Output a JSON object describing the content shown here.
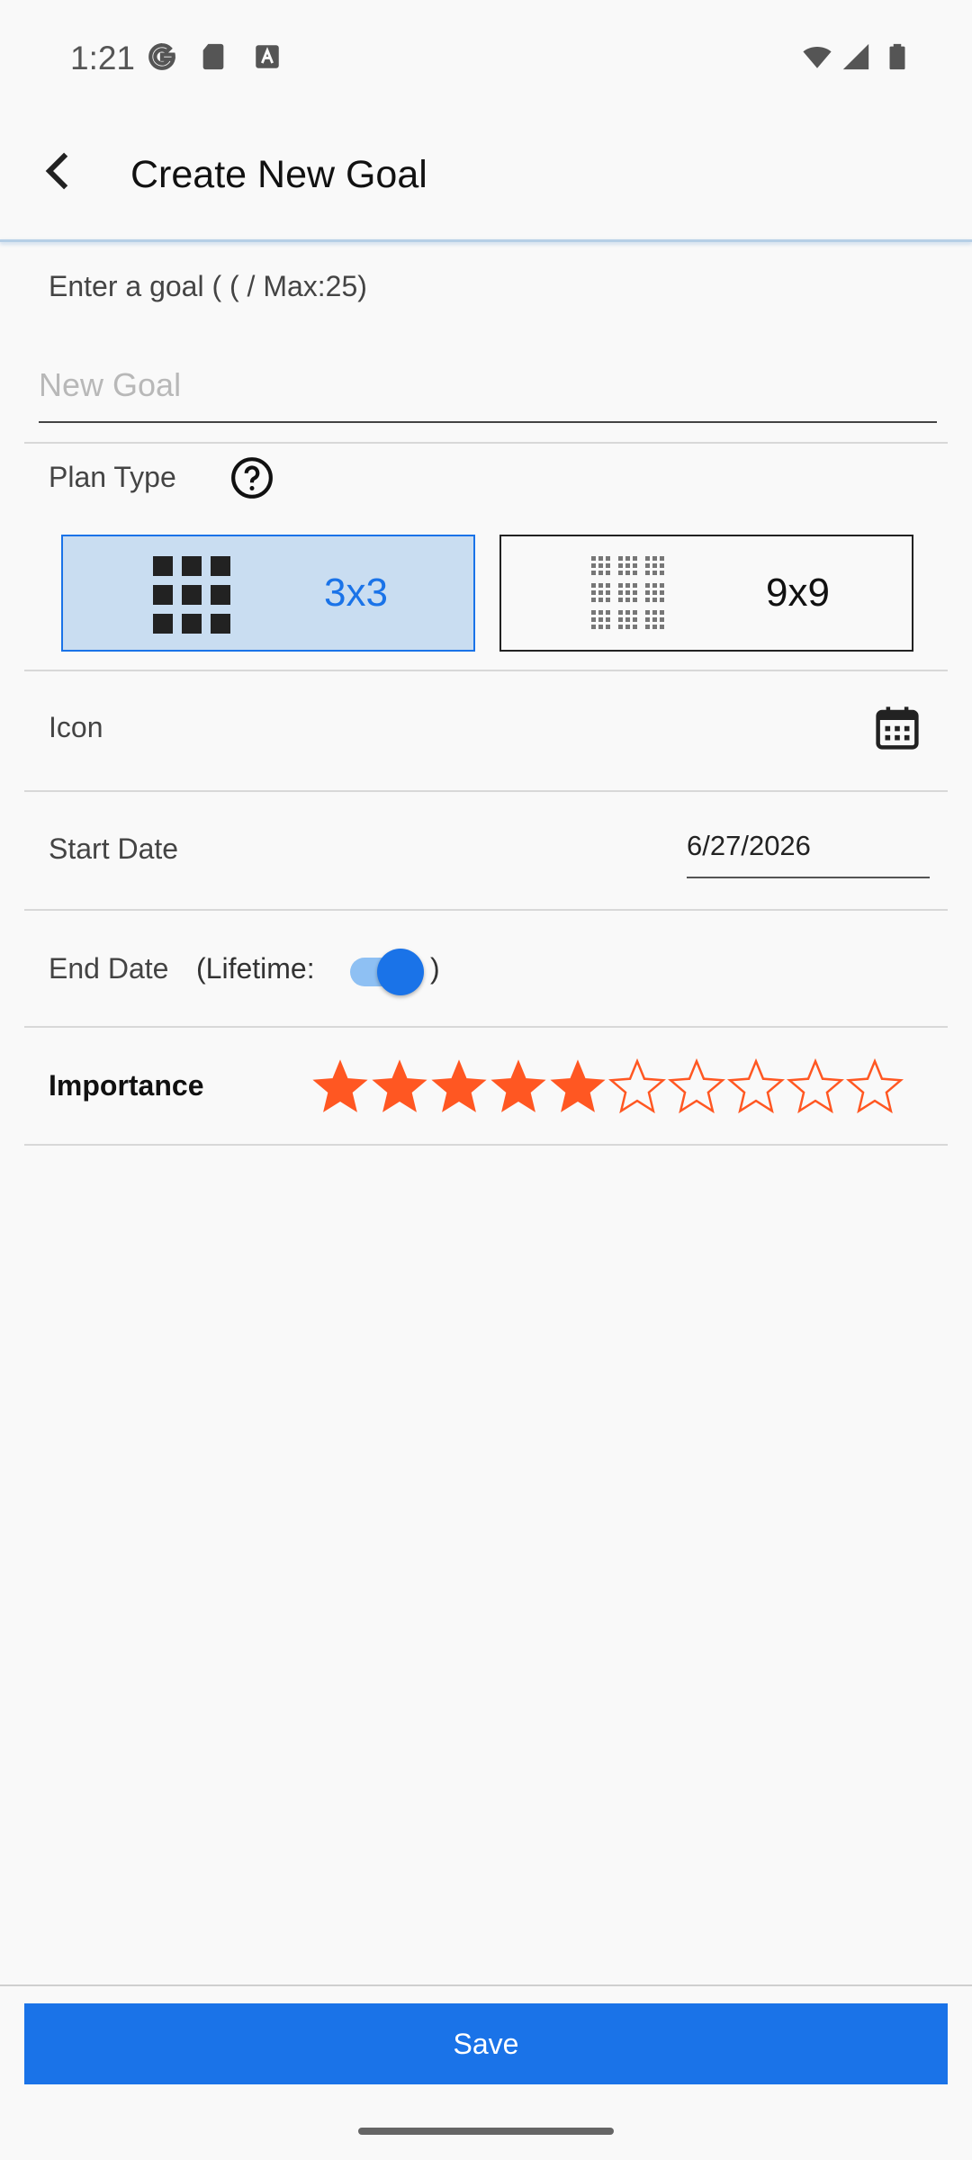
{
  "status_bar": {
    "time": "1:21",
    "left_icons": [
      "google-icon",
      "sd-card-icon",
      "a-icon"
    ],
    "right_icons": [
      "wifi-icon",
      "signal-icon",
      "battery-icon"
    ]
  },
  "app_bar": {
    "back_icon": "back-arrow-icon",
    "title": "Create New Goal"
  },
  "goal": {
    "label": "Enter a goal ( (  / Max:25)",
    "placeholder": "New Goal",
    "value": ""
  },
  "plan_type": {
    "label": "Plan Type",
    "help_icon": "help-circle-icon",
    "options": [
      {
        "label": "3x3",
        "selected": true,
        "icon": "grid-3x3-icon"
      },
      {
        "label": "9x9",
        "selected": false,
        "icon": "grid-9x9-icon"
      }
    ]
  },
  "icon_row": {
    "label": "Icon",
    "icon": "calendar-icon"
  },
  "start_date": {
    "label": "Start Date",
    "value": "6/27/2026"
  },
  "end_date": {
    "label": "End Date",
    "lifetime_label": "(Lifetime:",
    "lifetime_close": ")",
    "lifetime_on": true
  },
  "importance": {
    "label": "Importance",
    "rating": 5,
    "max": 10
  },
  "save": {
    "label": "Save"
  },
  "colors": {
    "accent": "#1a73e8",
    "star": "#ff5722",
    "selected_bg": "#c9ddf1"
  }
}
